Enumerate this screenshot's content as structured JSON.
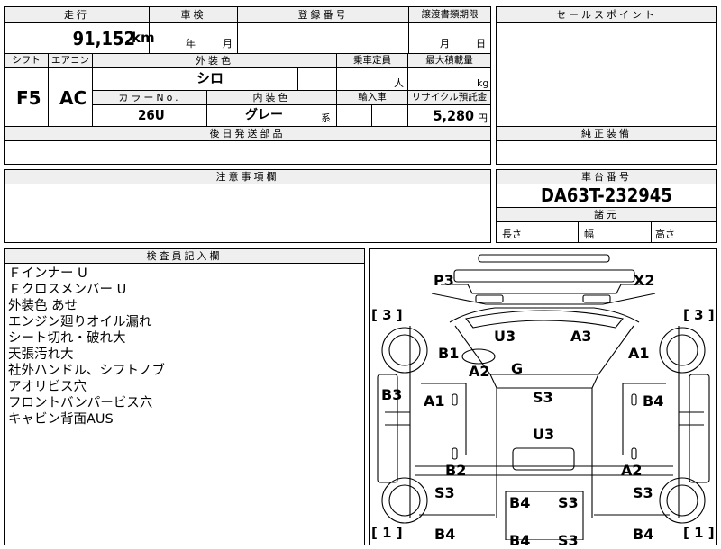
{
  "top": {
    "mileage_header": "走行",
    "mileage_value": "91,152",
    "mileage_unit": "km",
    "inspection_header": "車検",
    "inspection_year": "年",
    "inspection_month": "月",
    "registration_header": "登録番号",
    "transfer_header": "譲渡書類期限",
    "transfer_month": "月",
    "transfer_day": "日",
    "sales_header": "セールスポイント"
  },
  "spec": {
    "shift_header": "シフト",
    "shift_value": "F5",
    "aircon_header": "エアコン",
    "aircon_value": "AC",
    "exterior_header": "外装色",
    "exterior_value": "シロ",
    "capacity_header": "乗車定員",
    "capacity_unit": "人",
    "load_header": "最大積載量",
    "load_unit": "kg",
    "color_no_header": "カラーNo.",
    "color_no_value": "26U",
    "interior_header": "内装色",
    "interior_value": "グレー",
    "interior_suffix": "系",
    "import_header": "輸入車",
    "recycle_header": "リサイクル預託金",
    "recycle_value": "5,280",
    "recycle_unit": "円",
    "later_parts_header": "後日発送部品",
    "genuine_header": "純正装備"
  },
  "notes": {
    "caution_header": "注意事項欄",
    "chassis_header": "車台番号",
    "chassis_value": "DA63T-232945",
    "dimensions_header": "諸元",
    "length_label": "長さ",
    "width_label": "幅",
    "height_label": "高さ"
  },
  "inspector": {
    "header": "検査員記入欄",
    "comments": [
      "Ｆインナー U",
      "Ｆクロスメンバー U",
      "外装色 あせ",
      "エンジン廻りオイル漏れ",
      "シート切れ・破れ大",
      "天張汚れ大",
      "社外ハンドル、シフトノブ",
      "アオリビス穴",
      "フロントバンパービス穴",
      "キャビン背面AUS"
    ]
  },
  "diagram": {
    "codes": {
      "p3": "P3",
      "x2": "X2",
      "u3_top": "U3",
      "a3": "A3",
      "b1": "B1",
      "a1_right_top": "A1",
      "a2_left": "A2",
      "g": "G",
      "b3": "B3",
      "a1_left": "A1",
      "s3_center": "S3",
      "b4_right": "B4",
      "u3_center": "U3",
      "b2": "B2",
      "a2_right": "A2",
      "s3_left": "S3",
      "b4_bed_left": "B4",
      "s3_bed": "S3",
      "s3_right": "S3",
      "b4_bottom_left": "B4",
      "b4_bottom_right": "B4",
      "b4_bed_bottom": "B4",
      "s3_bed_bottom": "S3"
    },
    "brackets": {
      "left_top": "[ 3 ]",
      "right_top": "[ 3 ]",
      "left_bottom": "[ 1 ]",
      "right_bottom": "[ 1 ]"
    }
  }
}
